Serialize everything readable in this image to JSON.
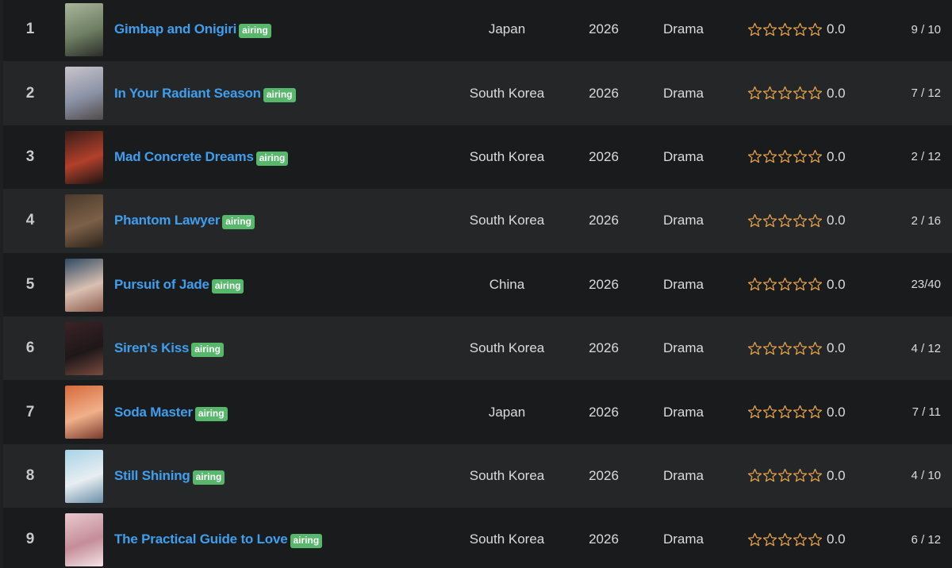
{
  "colors": {
    "title_link": "#3f9fee",
    "badge_bg": "#57b76a",
    "star_outline": "#e6a24a",
    "row_dark": "#1a1b1d",
    "row_light": "#252628"
  },
  "rows": [
    {
      "rank": "1",
      "title": "Gimbap and Onigiri",
      "badge": "airing",
      "country": "Japan",
      "year": "2026",
      "genre": "Drama",
      "rating": "0.0",
      "stars_filled": 0,
      "episodes": "9 / 10",
      "poster_colors": [
        "#a9b59a",
        "#6f7f63",
        "#2b2c2a"
      ]
    },
    {
      "rank": "2",
      "title": "In Your Radiant Season",
      "badge": "airing",
      "country": "South Korea",
      "year": "2026",
      "genre": "Drama",
      "rating": "0.0",
      "stars_filled": 0,
      "episodes": "7 / 12",
      "poster_colors": [
        "#c9c4cc",
        "#8b92a6",
        "#514a4a"
      ]
    },
    {
      "rank": "3",
      "title": "Mad Concrete Dreams",
      "badge": "airing",
      "country": "South Korea",
      "year": "2026",
      "genre": "Drama",
      "rating": "0.0",
      "stars_filled": 0,
      "episodes": "2 / 12",
      "poster_colors": [
        "#3a1d18",
        "#b2402b",
        "#1b1514"
      ]
    },
    {
      "rank": "4",
      "title": "Phantom Lawyer",
      "badge": "airing",
      "country": "South Korea",
      "year": "2026",
      "genre": "Drama",
      "rating": "0.0",
      "stars_filled": 0,
      "episodes": "2 / 16",
      "poster_colors": [
        "#4a3a2c",
        "#7c6048",
        "#2a221b"
      ]
    },
    {
      "rank": "5",
      "title": "Pursuit of Jade",
      "badge": "airing",
      "country": "China",
      "year": "2026",
      "genre": "Drama",
      "rating": "0.0",
      "stars_filled": 0,
      "episodes": "23/40",
      "poster_colors": [
        "#2f4a62",
        "#d9c0b2",
        "#8c5b4b"
      ]
    },
    {
      "rank": "6",
      "title": "Siren's Kiss",
      "badge": "airing",
      "country": "South Korea",
      "year": "2026",
      "genre": "Drama",
      "rating": "0.0",
      "stars_filled": 0,
      "episodes": "4 / 12",
      "poster_colors": [
        "#3b2226",
        "#1e1719",
        "#7a4b3e"
      ]
    },
    {
      "rank": "7",
      "title": "Soda Master",
      "badge": "airing",
      "country": "Japan",
      "year": "2026",
      "genre": "Drama",
      "rating": "0.0",
      "stars_filled": 0,
      "episodes": "7 / 11",
      "poster_colors": [
        "#d76a3b",
        "#f0b08a",
        "#7b3a2d"
      ]
    },
    {
      "rank": "8",
      "title": "Still Shining",
      "badge": "airing",
      "country": "South Korea",
      "year": "2026",
      "genre": "Drama",
      "rating": "0.0",
      "stars_filled": 0,
      "episodes": "4 / 10",
      "poster_colors": [
        "#a8d3e6",
        "#e8eef2",
        "#6b8fa8"
      ]
    },
    {
      "rank": "9",
      "title": "The Practical Guide to Love",
      "badge": "airing",
      "country": "South Korea",
      "year": "2026",
      "genre": "Drama",
      "rating": "0.0",
      "stars_filled": 0,
      "episodes": "6 / 12",
      "poster_colors": [
        "#e9c9cf",
        "#c48d98",
        "#f4e4e6"
      ]
    }
  ]
}
